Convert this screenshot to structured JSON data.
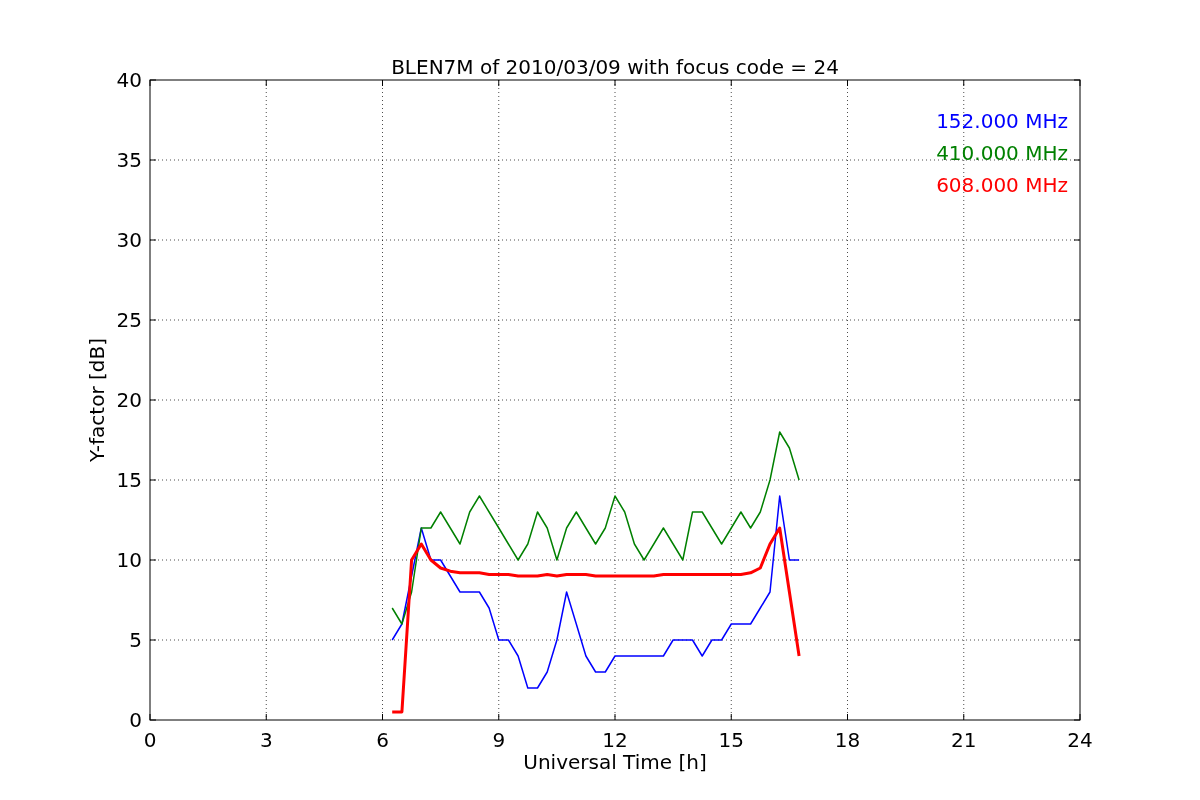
{
  "chart_data": {
    "type": "line",
    "title": "BLEN7M of 2010/03/09 with focus code = 24",
    "xlabel": "Universal Time [h]",
    "ylabel": "Y-factor [dB]",
    "x": [
      6.25,
      6.5,
      6.75,
      7,
      7.25,
      7.5,
      7.75,
      8,
      8.25,
      8.5,
      8.75,
      9,
      9.25,
      9.5,
      9.75,
      10,
      10.25,
      10.5,
      10.75,
      11,
      11.25,
      11.5,
      11.75,
      12,
      12.25,
      12.5,
      12.75,
      13,
      13.25,
      13.5,
      13.75,
      14,
      14.25,
      14.5,
      14.75,
      15,
      15.25,
      15.5,
      15.75,
      16,
      16.25,
      16.5,
      16.75
    ],
    "series": [
      {
        "name": "152.000 MHz",
        "color": "#0000ff",
        "values": [
          5,
          6,
          9,
          12,
          10,
          10,
          9,
          8,
          8,
          8,
          7,
          5,
          5,
          4,
          2,
          2,
          3,
          5,
          8,
          6,
          4,
          3,
          3,
          4,
          4,
          4,
          4,
          4,
          4,
          5,
          5,
          5,
          4,
          5,
          5,
          6,
          6,
          6,
          7,
          8,
          14,
          10,
          10
        ]
      },
      {
        "name": "410.000 MHz",
        "color": "#008000",
        "values": [
          7,
          6,
          8,
          12,
          12,
          13,
          12,
          11,
          13,
          14,
          13,
          12,
          11,
          10,
          11,
          13,
          12,
          10,
          12,
          13,
          12,
          11,
          12,
          14,
          13,
          11,
          10,
          11,
          12,
          11,
          10,
          13,
          13,
          12,
          11,
          12,
          13,
          12,
          13,
          15,
          18,
          17,
          15
        ]
      },
      {
        "name": "608.000 MHz",
        "color": "#ff0000",
        "values": [
          0.5,
          0.5,
          10,
          11,
          10,
          9.5,
          9.3,
          9.2,
          9.2,
          9.2,
          9.1,
          9.1,
          9.1,
          9,
          9,
          9,
          9.1,
          9,
          9.1,
          9.1,
          9.1,
          9,
          9,
          9,
          9,
          9,
          9,
          9,
          9.1,
          9.1,
          9.1,
          9.1,
          9.1,
          9.1,
          9.1,
          9.1,
          9.1,
          9.2,
          9.5,
          11,
          12,
          8,
          4
        ]
      }
    ],
    "xlim": [
      0,
      24
    ],
    "ylim": [
      0,
      40
    ],
    "xticks": [
      0,
      3,
      6,
      9,
      12,
      15,
      18,
      21,
      24
    ],
    "yticks": [
      0,
      5,
      10,
      15,
      20,
      25,
      30,
      35,
      40
    ],
    "grid": true
  }
}
